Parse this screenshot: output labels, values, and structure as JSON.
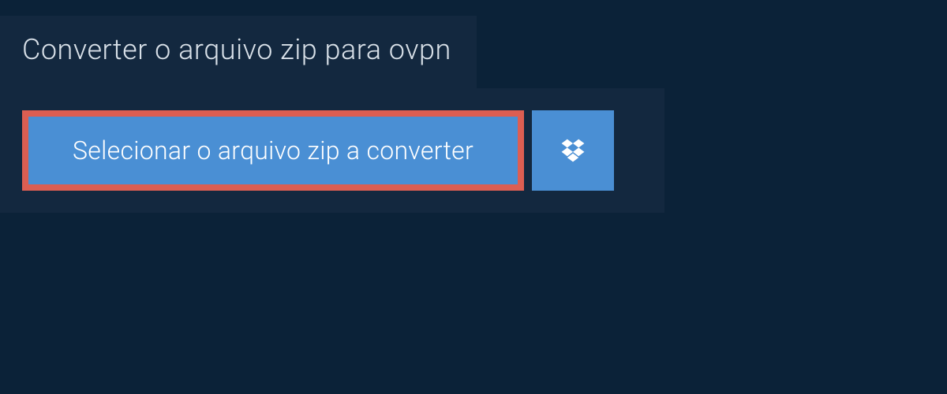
{
  "header": {
    "title": "Converter o arquivo zip para ovpn"
  },
  "buttons": {
    "select_file_label": "Selecionar o arquivo zip a converter"
  },
  "colors": {
    "background": "#0b2238",
    "panel": "#13283f",
    "button": "#4a8fd4",
    "highlight_border": "#dc5e52",
    "text_light": "#d8e0e8",
    "text_white": "#ffffff"
  }
}
